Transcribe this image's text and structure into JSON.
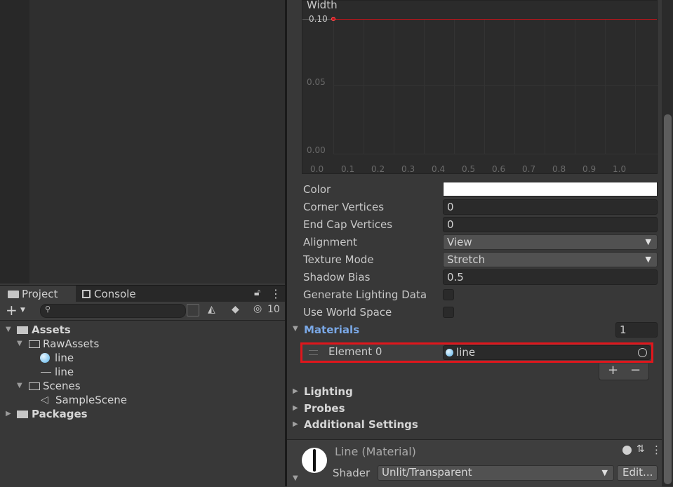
{
  "project": {
    "tabs": [
      {
        "label": "Project"
      },
      {
        "label": "Console"
      }
    ],
    "hidden_count": "10",
    "tree": [
      {
        "label": "Assets"
      },
      {
        "label": "RawAssets"
      },
      {
        "label": "line"
      },
      {
        "label": "line"
      },
      {
        "label": "Scenes"
      },
      {
        "label": "SampleScene"
      },
      {
        "label": "Packages"
      }
    ]
  },
  "curve": {
    "title": "Width",
    "y_ticks": [
      "0.10",
      "0.05",
      "0.00"
    ],
    "x_ticks": [
      "0.0",
      "0.1",
      "0.2",
      "0.3",
      "0.4",
      "0.5",
      "0.6",
      "0.7",
      "0.8",
      "0.9",
      "1.0"
    ]
  },
  "props": {
    "color_label": "Color",
    "corner_label": "Corner Vertices",
    "corner_value": "0",
    "endcap_label": "End Cap Vertices",
    "endcap_value": "0",
    "alignment_label": "Alignment",
    "alignment_value": "View",
    "texture_label": "Texture Mode",
    "texture_value": "Stretch",
    "shadow_label": "Shadow Bias",
    "shadow_value": "0.5",
    "lighting_data_label": "Generate Lighting Data",
    "world_space_label": "Use World Space",
    "color_swatch": "#ffffff"
  },
  "materials": {
    "label": "Materials",
    "count": "1",
    "element_label": "Element 0",
    "element_value": "line",
    "add": "+",
    "remove": "−"
  },
  "sections": {
    "lighting": "Lighting",
    "probes": "Probes",
    "additional": "Additional Settings"
  },
  "material_header": {
    "name": "Line (Material)",
    "shader_label": "Shader",
    "shader_value": "Unlit/Transparent",
    "edit_label": "Edit..."
  },
  "colors": {
    "highlight": "#e0161c",
    "curve_line": "#c0141a",
    "section_blue": "#7aa8e6"
  }
}
